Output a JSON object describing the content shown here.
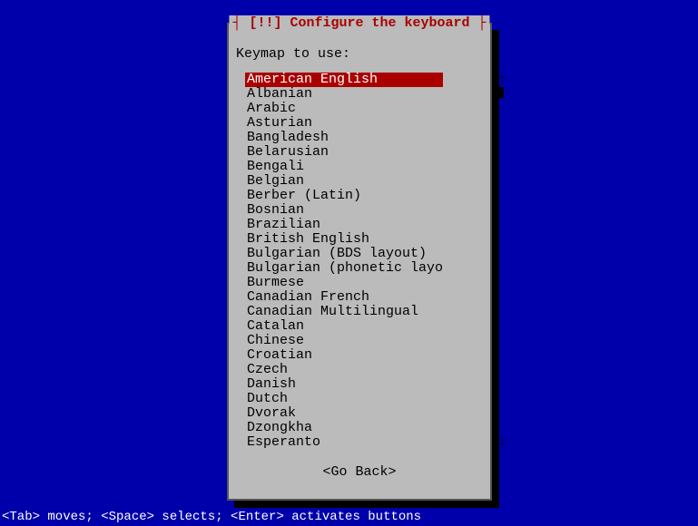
{
  "dialog": {
    "title_prefix": "┤ ",
    "title_marker": "[!!]",
    "title_text": " Configure the keyboard ",
    "title_suffix": "├",
    "prompt": "Keymap to use:",
    "go_back": "<Go Back>",
    "scroll_up": "↑",
    "scroll_down": "↓"
  },
  "keymaps": [
    "American English",
    "Albanian",
    "Arabic",
    "Asturian",
    "Bangladesh",
    "Belarusian",
    "Bengali",
    "Belgian",
    "Berber (Latin)",
    "Bosnian",
    "Brazilian",
    "British English",
    "Bulgarian (BDS layout)",
    "Bulgarian (phonetic layout)",
    "Burmese",
    "Canadian French",
    "Canadian Multilingual",
    "Catalan",
    "Chinese",
    "Croatian",
    "Czech",
    "Danish",
    "Dutch",
    "Dvorak",
    "Dzongkha",
    "Esperanto"
  ],
  "selected_index": 0,
  "footer": "<Tab> moves; <Space> selects; <Enter> activates buttons"
}
